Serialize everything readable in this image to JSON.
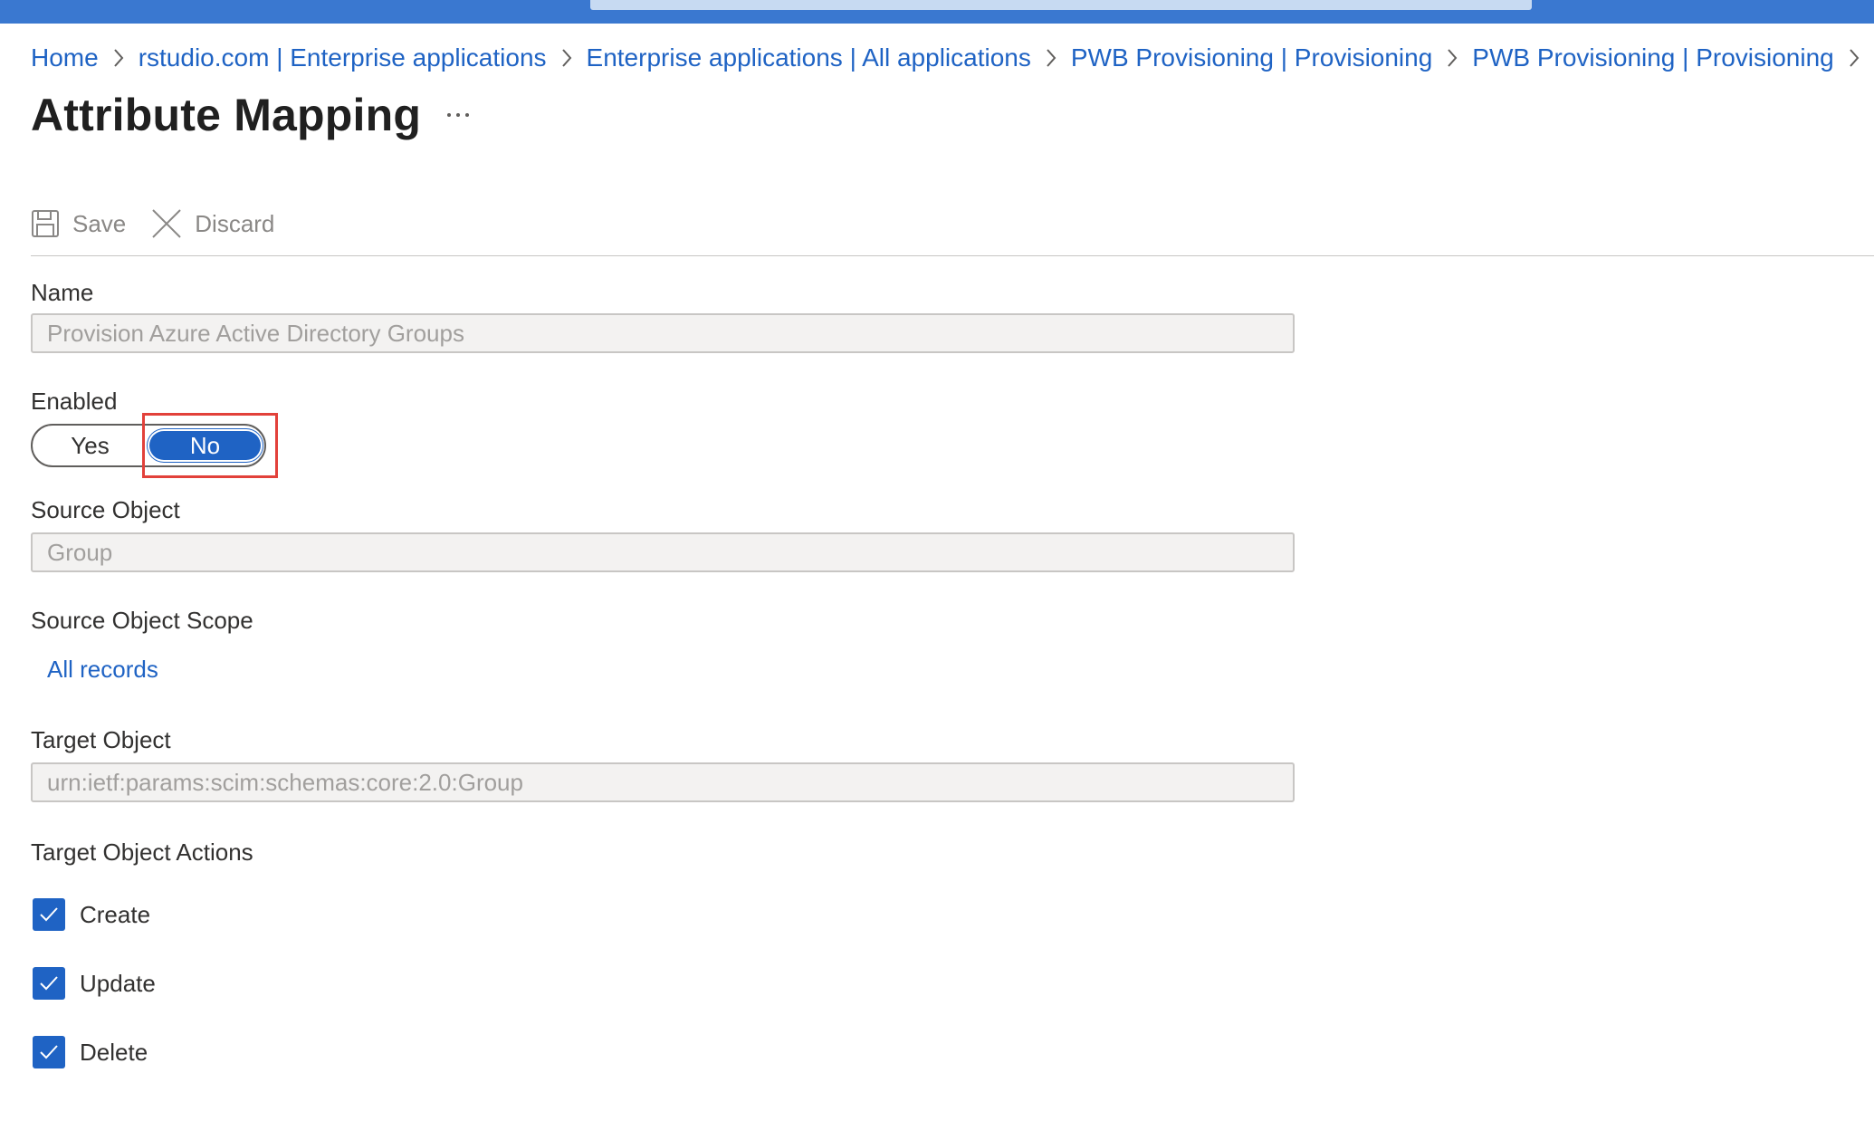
{
  "breadcrumb": [
    {
      "label": "Home"
    },
    {
      "label": "rstudio.com | Enterprise applications"
    },
    {
      "label": "Enterprise applications | All applications"
    },
    {
      "label": "PWB Provisioning | Provisioning"
    },
    {
      "label": "PWB Provisioning | Provisioning"
    }
  ],
  "page": {
    "title": "Attribute Mapping",
    "more_label": "···"
  },
  "toolbar": {
    "save_label": "Save",
    "discard_label": "Discard",
    "save_icon": "save-icon",
    "discard_icon": "close-icon"
  },
  "form": {
    "name_label": "Name",
    "name_value": "Provision Azure Active Directory Groups",
    "enabled_label": "Enabled",
    "enabled_yes": "Yes",
    "enabled_no": "No",
    "enabled_selected": "No",
    "source_object_label": "Source Object",
    "source_object_value": "Group",
    "source_scope_label": "Source Object Scope",
    "source_scope_link": "All records",
    "target_object_label": "Target Object",
    "target_object_value": "urn:ietf:params:scim:schemas:core:2.0:Group",
    "target_actions_label": "Target Object Actions",
    "actions": [
      {
        "label": "Create",
        "checked": true
      },
      {
        "label": "Update",
        "checked": true
      },
      {
        "label": "Delete",
        "checked": true
      }
    ]
  },
  "colors": {
    "accent": "#1f63c4",
    "top_bar": "#3a78d0",
    "highlight": "#e2413a"
  }
}
